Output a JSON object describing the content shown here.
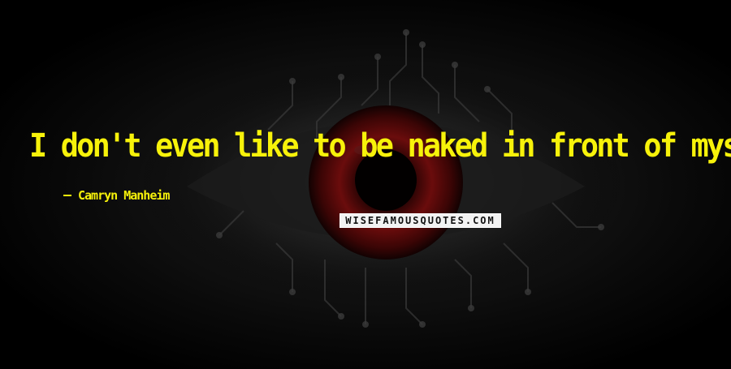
{
  "quote": {
    "text": "I don't even like to be naked in front of myself!"
  },
  "author": {
    "dash": "",
    "name": "Camryn Manheim"
  },
  "watermark": {
    "text": "WISEFAMOUSQUOTES.COM"
  },
  "colors": {
    "quote_text": "#f7f20a",
    "background": "#000000",
    "iris": "#6a0c0c",
    "watermark_bg": "#f2f2f2"
  }
}
